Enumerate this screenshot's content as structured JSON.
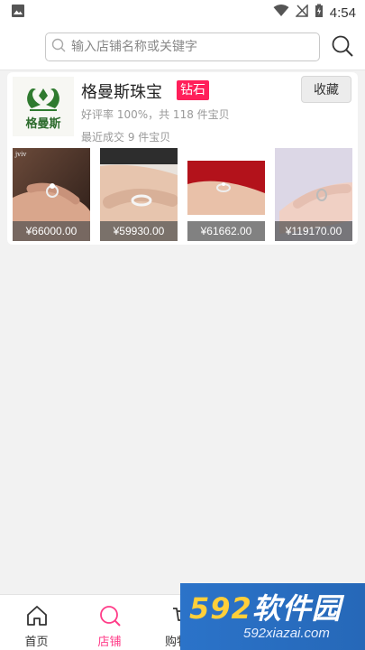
{
  "status_bar": {
    "time": "4:54"
  },
  "search": {
    "placeholder": "输入店铺名称或关键字"
  },
  "shop": {
    "logo_text": "格曼斯",
    "name": "格曼斯珠宝",
    "badge": "钻石",
    "favorite_label": "收藏",
    "rating_text": "好评率 100%，共 118 件宝贝",
    "recent_text": "最近成交 9 件宝贝",
    "products": [
      {
        "price": "¥66000.00",
        "tag": "jviv"
      },
      {
        "price": "¥59930.00"
      },
      {
        "price": "¥61662.00"
      },
      {
        "price": "¥119170.00"
      }
    ]
  },
  "tabs": [
    {
      "label": "首页",
      "icon": "home-icon"
    },
    {
      "label": "店铺",
      "icon": "search-icon",
      "active": true
    },
    {
      "label": "购物车",
      "icon": "cart-icon"
    },
    {
      "label": "",
      "icon": "chat-icon"
    },
    {
      "label": "",
      "icon": "user-icon"
    }
  ],
  "watermark": {
    "big_num": "592",
    "big_text": "软件园",
    "small": "592xiazai.com"
  },
  "colors": {
    "accent": "#ff3c88",
    "badge": "#ff1f5a",
    "watermark_bg": "#2b73c9"
  }
}
